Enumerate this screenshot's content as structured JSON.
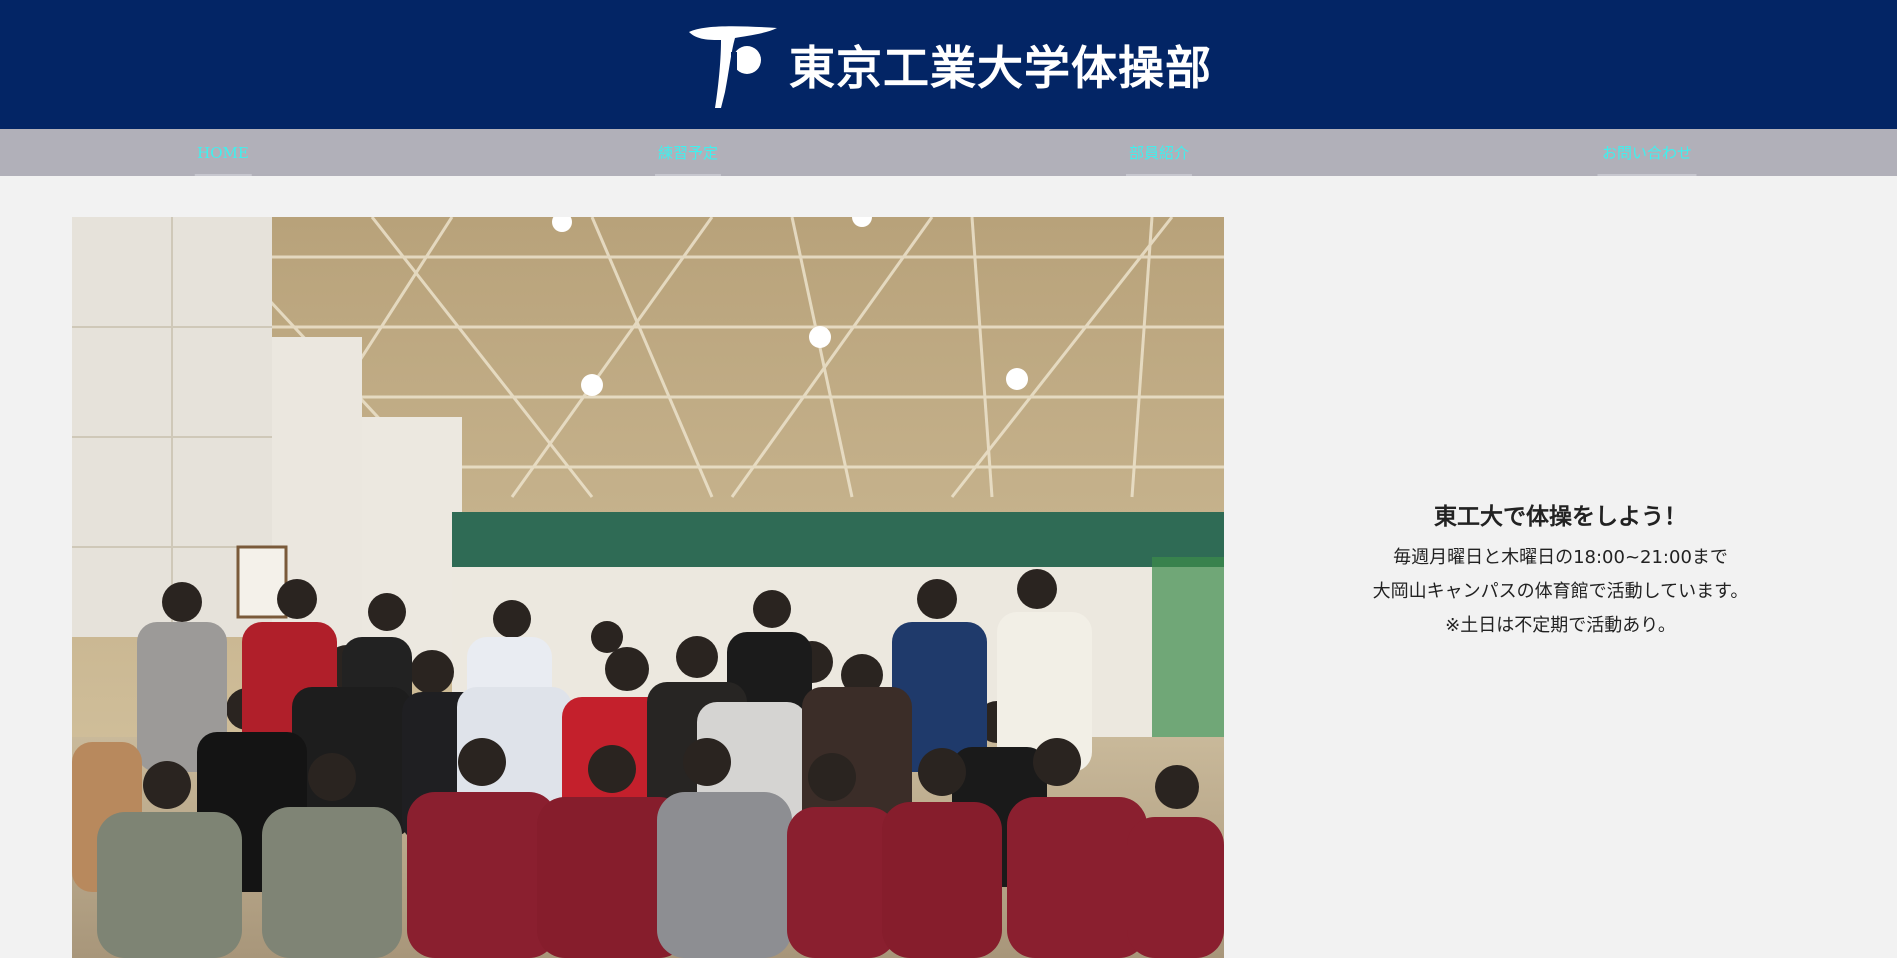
{
  "header": {
    "title": "東京工業大学体操部"
  },
  "nav": {
    "items": [
      {
        "label": "HOME"
      },
      {
        "label": "練習予定"
      },
      {
        "label": "部員紹介"
      },
      {
        "label": "お問い合わせ"
      }
    ]
  },
  "intro": {
    "heading": "東工大で体操をしよう！",
    "lines": [
      "毎週月曜日と木曜日の18:00~21:00まで",
      "大岡山キャンパスの体育館で活動しています。",
      "※土日は不定期で活動あり。"
    ]
  },
  "colors": {
    "header_bg": "#032565",
    "nav_bg": "#b1b0b9",
    "nav_link": "#3ff0ee",
    "page_bg": "#f2f2f2"
  }
}
